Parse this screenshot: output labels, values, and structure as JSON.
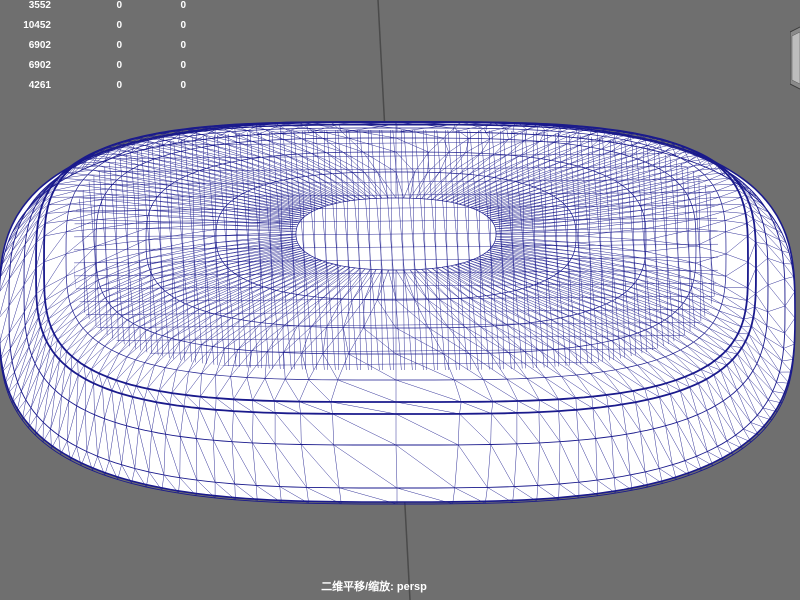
{
  "hud": {
    "rows": [
      [
        "3552",
        "0",
        "0"
      ],
      [
        "10452",
        "0",
        "0"
      ],
      [
        "6902",
        "0",
        "0"
      ],
      [
        "6902",
        "0",
        "0"
      ],
      [
        "4261",
        "0",
        "0"
      ]
    ]
  },
  "camera_label": "二维平移/缩放: persp",
  "colors": {
    "background": "#6f6f6f",
    "mesh_fill": "#ffffff",
    "wire": "#1a1a8c",
    "axis": "#4a4a4a",
    "hud_text": "#ffffff"
  },
  "icons": {
    "view_cube": "view-cube-icon"
  }
}
